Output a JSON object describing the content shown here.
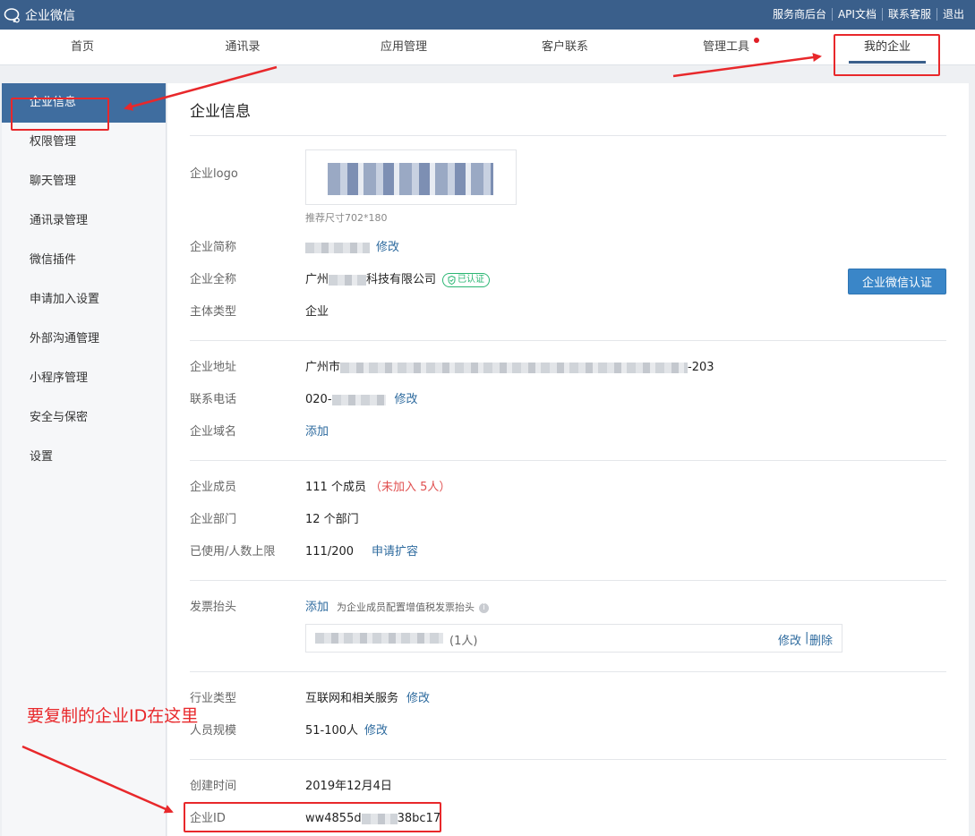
{
  "topbar": {
    "brand": "企业微信",
    "links": [
      "服务商后台",
      "API文档",
      "联系客服",
      "退出"
    ]
  },
  "nav": {
    "items": [
      "首页",
      "通讯录",
      "应用管理",
      "客户联系",
      "管理工具",
      "我的企业"
    ],
    "active": "我的企业"
  },
  "sidebar": {
    "items": [
      "企业信息",
      "权限管理",
      "聊天管理",
      "通讯录管理",
      "微信插件",
      "申请加入设置",
      "外部沟通管理",
      "小程序管理",
      "安全与保密",
      "设置"
    ],
    "active": "企业信息"
  },
  "main": {
    "title": "企业信息",
    "logo_label": "企业logo",
    "logo_hint": "推荐尺寸702*180",
    "short_name_label": "企业简称",
    "short_name_edit": "修改",
    "full_name_label": "企业全称",
    "full_name_prefix": "广州",
    "full_name_suffix": "科技有限公司",
    "verified_badge": "已认证",
    "cert_button": "企业微信认证",
    "entity_type_label": "主体类型",
    "entity_type_value": "企业",
    "address_label": "企业地址",
    "address_prefix": "广州市",
    "address_suffix": "-203",
    "phone_label": "联系电话",
    "phone_prefix": "020-",
    "phone_edit": "修改",
    "domain_label": "企业域名",
    "domain_add": "添加",
    "members_label": "企业成员",
    "members_value": "111 个成员",
    "members_unjoined": "（未加入 5人）",
    "departments_label": "企业部门",
    "departments_value": "12 个部门",
    "usage_label": "已使用/人数上限",
    "usage_value": "111/200",
    "usage_expand": "申请扩容",
    "invoice_label": "发票抬头",
    "invoice_add": "添加",
    "invoice_hint": "为企业成员配置增值税发票抬头",
    "invoice_count": "(1人)",
    "invoice_edit": "修改",
    "invoice_delete": "删除",
    "industry_label": "行业类型",
    "industry_value": "互联网和相关服务",
    "industry_edit": "修改",
    "scale_label": "人员规模",
    "scale_value": "51-100人",
    "scale_edit": "修改",
    "created_label": "创建时间",
    "created_value": "2019年12月4日",
    "corp_id_label": "企业ID",
    "corp_id_prefix": "ww4855d",
    "corp_id_suffix": "38bc17"
  },
  "annotation": {
    "text": "要复制的企业ID在这里"
  },
  "colors": {
    "topbar": "#3a5f8b",
    "sidebar_active": "#3f6d9f",
    "link": "#2d6a9e",
    "annotation": "#e8282b",
    "verified": "#2bb673",
    "unjoined": "#e05050"
  }
}
